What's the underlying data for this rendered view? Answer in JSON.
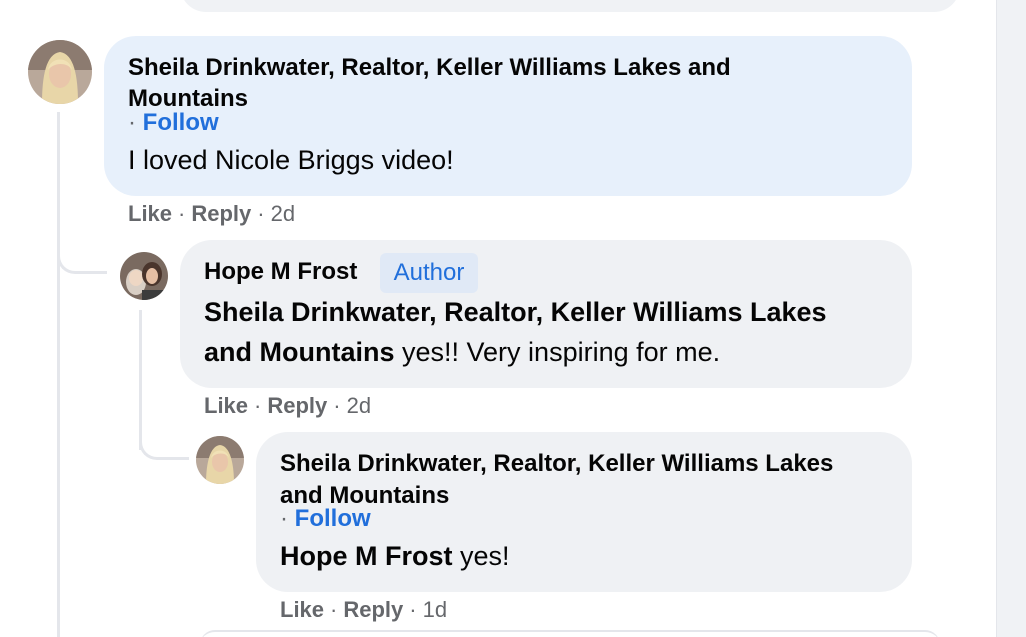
{
  "comments": [
    {
      "author": "Sheila Drinkwater, Realtor, Keller Williams Lakes and",
      "author_cont": "Mountains",
      "follow_sep": "·",
      "follow_label": "Follow",
      "text": "I loved Nicole Briggs video!",
      "like_label": "Like",
      "reply_label": "Reply",
      "dot": "·",
      "time": "2d"
    },
    {
      "author": "Hope M Frost",
      "badge": "Author",
      "mention_line1": "Sheila Drinkwater, Realtor, Keller Williams Lakes",
      "mention_line2": "and Mountains",
      "text": " yes!! Very inspiring for me.",
      "like_label": "Like",
      "reply_label": "Reply",
      "dot": "·",
      "time": "2d"
    },
    {
      "author": "Sheila Drinkwater, Realtor, Keller Williams Lakes",
      "author_cont": "and Mountains",
      "follow_sep": "·",
      "follow_label": "Follow",
      "mention": "Hope M Frost",
      "text": " yes!",
      "like_label": "Like",
      "reply_label": "Reply",
      "dot": "·",
      "time": "1d"
    }
  ],
  "colors": {
    "link_blue": "#216fdb",
    "bubble_highlight": "#e7f0fb",
    "bubble_default": "#eff1f4",
    "meta_gray": "#65676b"
  },
  "icons": {
    "avatar_sheila": "profile-photo",
    "avatar_hope": "profile-photo"
  }
}
